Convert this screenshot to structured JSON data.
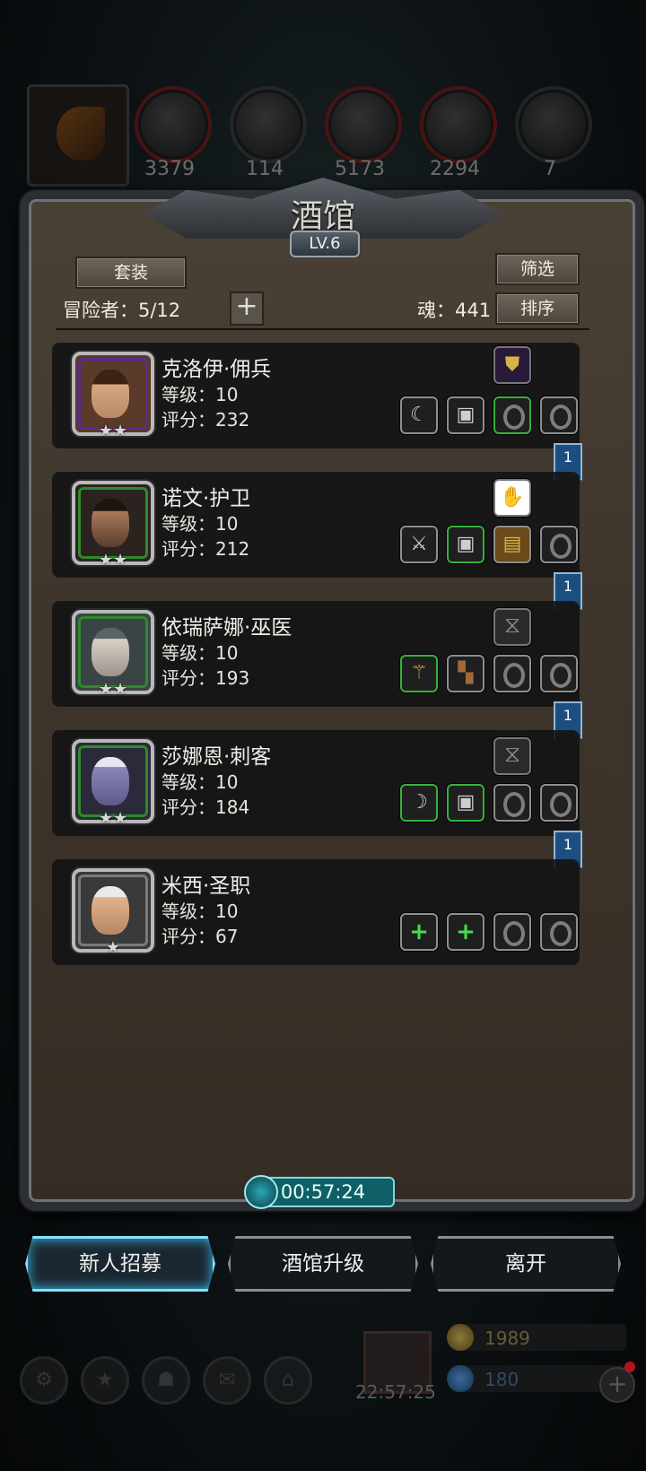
{
  "resources": [
    {
      "icon": "meat-icon",
      "value": "3379"
    },
    {
      "icon": "wood-icon",
      "value": "114"
    },
    {
      "icon": "iron-icon",
      "value": "5173"
    },
    {
      "icon": "crystal-icon",
      "value": "2294"
    },
    {
      "icon": "ore-icon",
      "value": "7"
    }
  ],
  "panel": {
    "title": "酒馆",
    "level": "LV.6",
    "suit_button": "套装",
    "filter_button": "筛选",
    "sort_button": "排序",
    "adventurers": "冒险者：5/12",
    "soul": "魂：441"
  },
  "heroes": [
    {
      "name": "克洛伊·佣兵",
      "level": "等级：10",
      "score": "评分：232",
      "stars": "★★",
      "rarity": "purple",
      "flag": "1"
    },
    {
      "name": "诺文·护卫",
      "level": "等级：10",
      "score": "评分：212",
      "stars": "★★",
      "rarity": "green",
      "flag": "1"
    },
    {
      "name": "依瑞萨娜·巫医",
      "level": "等级：10",
      "score": "评分：193",
      "stars": "★★",
      "rarity": "green",
      "flag": "1"
    },
    {
      "name": "莎娜恩·刺客",
      "level": "等级：10",
      "score": "评分：184",
      "stars": "★★",
      "rarity": "green",
      "flag": "1"
    },
    {
      "name": "米西·圣职",
      "level": "等级：10",
      "score": "评分：67",
      "stars": "★",
      "rarity": "gray",
      "flag": ""
    }
  ],
  "timer": "00:57:24",
  "buttons": {
    "recruit": "新人招募",
    "upgrade": "酒馆升级",
    "leave": "离开"
  },
  "hud": {
    "gold": "1989",
    "gems": "180",
    "time": "22:57:25"
  },
  "colors": {
    "accent_cyan": "#7fe4ff",
    "equip_green": "#33b43a",
    "rarity_purple": "#5e2a8e",
    "rarity_green": "#2f8a2a",
    "flag_blue": "#1c4f80"
  }
}
